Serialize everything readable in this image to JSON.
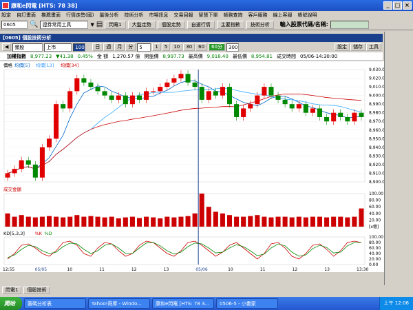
{
  "window": {
    "title": "康和e閃電 [HTS: 78 38]"
  },
  "menu": [
    "設定",
    "自訂畫面",
    "推薦畫面",
    "行情走勢(國)",
    "盤後分析",
    "技術分析",
    "市場訊息",
    "交易回報",
    "智慧下單",
    "帳務查詢",
    "客戶服務",
    "線上客服",
    "帳號說明"
  ],
  "toolbar": {
    "symbol": "0605",
    "list": "證券常用工具",
    "buttons": [
      "閃電1",
      "大盤走勢",
      "個股走勢",
      "自選行情",
      "主要指數",
      "技術分析"
    ],
    "input_label": "輸入股票代碼/名稱:"
  },
  "panel": {
    "title": "[0605] 個股技術分析"
  },
  "controls": {
    "type": "類股",
    "market": "上市",
    "code": "100",
    "periods": [
      "日",
      "週",
      "月",
      "分"
    ],
    "minute_value": "5",
    "intervals": [
      "1",
      "5",
      "10",
      "30",
      "60"
    ],
    "active": "60分",
    "count": "300",
    "right_buttons": [
      "設定",
      "儲存",
      "工具"
    ]
  },
  "info": {
    "name": "加權指數",
    "price": "8,977.23",
    "change": "▼41.38",
    "pct": "0.45%",
    "amount_label": "金 額",
    "amount": "1,270.57 億",
    "open_label": "開盤價",
    "open": "8,997.73",
    "high_label": "最高價",
    "high": "9,018.40",
    "low_label": "最低價",
    "low": "8,954.81",
    "time_label": "成交時間",
    "time": "05/06-14:30:00"
  },
  "price_legend": [
    "價格",
    "均價[5]",
    "均價[13]",
    "均價[34]"
  ],
  "volume_legend": "成交金額",
  "kd_legend": [
    "KD[5,3,3]",
    "%K",
    "%D"
  ],
  "price_axis": [
    "9,030.00",
    "9,020.00",
    "9,010.00",
    "9,000.00",
    "8,990.00",
    "8,980.00",
    "8,970.00",
    "8,960.00",
    "8,950.00",
    "8,940.00",
    "8,930.00",
    "8,920.00",
    "8,910.00",
    "8,900.00"
  ],
  "volume_axis": [
    "100.00",
    "80.00",
    "60.00",
    "40.00",
    "20.00",
    "[x億]"
  ],
  "kd_axis": [
    "100.00",
    "80.00",
    "60.00",
    "40.00",
    "20.00",
    "0.00"
  ],
  "time_axis": [
    "12:55",
    "05/05",
    "10",
    "11",
    "12",
    "13",
    "05/06",
    "10",
    "11",
    "12",
    "13",
    "13:30"
  ],
  "time_zoom": "119",
  "tabs": [
    "閃電1",
    "個股技術"
  ],
  "taskbar": {
    "start": "開始",
    "tasks": [
      "籌碼分析表",
      "Yahoo!奇摩 - Windo...",
      "康和e閃電 [HTS: 78 3...",
      "0506-5 - 小畫家"
    ],
    "clock": "上午 12:06"
  },
  "chart_data": {
    "type": "candlestick",
    "close": [
      8910,
      8915,
      8925,
      8920,
      8905,
      8940,
      8950,
      8990,
      8985,
      9005,
      9020,
      9015,
      9010,
      9005,
      9000,
      8995,
      9000,
      8990,
      9000,
      8995,
      9005,
      9005,
      9010,
      9015,
      9020,
      9025,
      9015,
      9010,
      8995,
      9005,
      9000,
      9010,
      8990,
      8975,
      8985,
      8990,
      9000,
      9010,
      9000,
      8995,
      8990,
      8985,
      8990,
      8980,
      8985,
      8975,
      8970,
      8980,
      8975,
      8970,
      8980,
      8975
    ],
    "volume": [
      40,
      30,
      35,
      30,
      28,
      30,
      32,
      30,
      28,
      30,
      35,
      30,
      32,
      30,
      28,
      30,
      25,
      28,
      30,
      26,
      30,
      28,
      25,
      30,
      28,
      30,
      32,
      40,
      100,
      60,
      45,
      40,
      35,
      30,
      30,
      32,
      35,
      30,
      28,
      30,
      30,
      28,
      30,
      28,
      30,
      30,
      28,
      30,
      30,
      28,
      30,
      55
    ],
    "k": [
      20,
      40,
      70,
      75,
      60,
      40,
      30,
      50,
      80,
      85,
      70,
      40,
      30,
      60,
      80,
      75,
      50,
      30,
      40,
      70,
      85,
      80,
      60,
      40,
      30,
      50,
      80,
      85,
      70,
      50,
      30,
      45,
      70,
      80,
      60,
      40,
      20,
      40,
      75,
      80,
      60,
      30,
      20,
      40,
      70,
      75,
      55,
      30,
      50,
      80,
      85,
      80
    ],
    "d": [
      25,
      35,
      55,
      70,
      65,
      50,
      40,
      45,
      65,
      78,
      75,
      55,
      40,
      50,
      70,
      75,
      60,
      40,
      40,
      60,
      78,
      80,
      68,
      50,
      38,
      45,
      65,
      78,
      75,
      60,
      42,
      45,
      60,
      72,
      65,
      50,
      32,
      38,
      60,
      75,
      68,
      45,
      30,
      35,
      58,
      70,
      62,
      42,
      45,
      68,
      80,
      80
    ],
    "price_range": [
      8900,
      9030
    ],
    "volume_range": [
      0,
      100
    ],
    "kd_range": [
      0,
      100
    ]
  }
}
